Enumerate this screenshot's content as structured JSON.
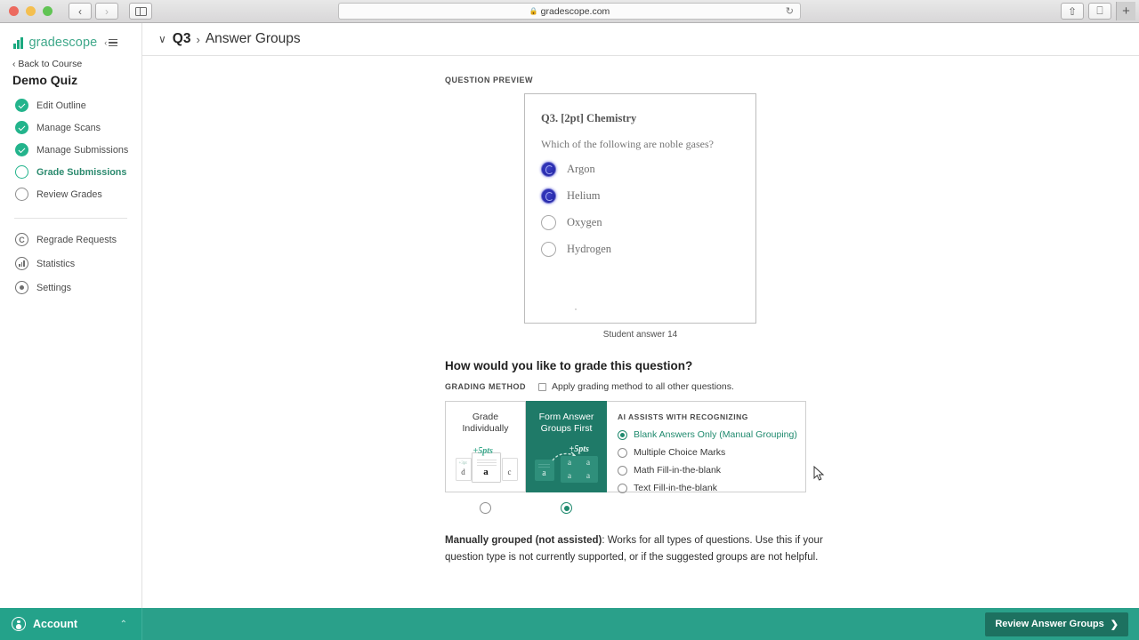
{
  "browser": {
    "url": "gradescope.com",
    "lock_icon": "lock-icon",
    "reload_icon": "reload-icon",
    "back_icon": "‹",
    "forward_icon": "›",
    "share_icon": "share-icon",
    "tabs_icon": "tabs-icon",
    "new_tab_icon": "+"
  },
  "sidebar": {
    "brand": "gradescope",
    "collapse_chevron": "‹",
    "back_link": "‹ Back to Course",
    "quiz_title": "Demo Quiz",
    "items": [
      {
        "label": "Edit Outline",
        "state": "done"
      },
      {
        "label": "Manage Scans",
        "state": "done"
      },
      {
        "label": "Manage Submissions",
        "state": "done"
      },
      {
        "label": "Grade Submissions",
        "state": "current"
      },
      {
        "label": "Review Grades",
        "state": "pending"
      }
    ],
    "secondary": [
      {
        "label": "Regrade Requests",
        "icon": "regrade-icon",
        "glyph": "C"
      },
      {
        "label": "Statistics",
        "icon": "statistics-icon",
        "glyph": ""
      },
      {
        "label": "Settings",
        "icon": "settings-gear-icon",
        "glyph": ""
      }
    ]
  },
  "header": {
    "chevron": "∨",
    "question": "Q3",
    "separator": "›",
    "title": "Answer Groups"
  },
  "preview": {
    "section_label": "QUESTION PREVIEW",
    "question_title": "Q3. [2pt] Chemistry",
    "question_text": "Which of the following are noble gases?",
    "options": [
      {
        "label": "Argon",
        "marked": true
      },
      {
        "label": "Helium",
        "marked": true
      },
      {
        "label": "Oxygen",
        "marked": false
      },
      {
        "label": "Hydrogen",
        "marked": false
      }
    ],
    "caption": "Student answer 14"
  },
  "grading": {
    "heading": "How would you like to grade this question?",
    "method_label": "GRADING METHOD",
    "apply_all_label": "Apply grading method to all other questions.",
    "apply_all_checked": false,
    "cards": [
      {
        "title": "Grade\nIndividually",
        "title_line1": "Grade",
        "title_line2": "Individually",
        "selected": false,
        "illustration": {
          "left_letter": "d",
          "center_letter": "a",
          "right_letter": "c",
          "points": "+5pts",
          "small_scribble": "+3pt"
        }
      },
      {
        "title": "Form Answer\nGroups First",
        "title_line1": "Form Answer",
        "title_line2": "Groups First",
        "selected": true,
        "illustration": {
          "source_letter": "a",
          "group_letters": [
            "a",
            "a",
            "a",
            "a"
          ],
          "points": "+5pts"
        }
      }
    ],
    "ai_panel": {
      "label": "AI ASSISTS WITH RECOGNIZING",
      "options": [
        {
          "label": "Blank Answers Only (Manual Grouping)",
          "selected": true
        },
        {
          "label": "Multiple Choice Marks",
          "selected": false
        },
        {
          "label": "Math Fill-in-the-blank",
          "selected": false
        },
        {
          "label": "Text Fill-in-the-blank",
          "selected": false
        }
      ]
    },
    "description_bold": "Manually grouped (not assisted)",
    "description_rest": ": Works for all types of questions. Use this if your question type is not currently supported, or if the suggested groups are not helpful."
  },
  "footer": {
    "account_label": "Account",
    "account_chevron": "⌃",
    "review_button": "Review Answer Groups",
    "review_chevron": "❯"
  },
  "colors": {
    "brand_teal": "#3fa88a",
    "accent_green": "#23b48c",
    "card_selected": "#1f7a68",
    "footer_bg": "#2aa08a",
    "footer_btn": "#1d7160",
    "mark_blue": "#2a2db0"
  }
}
